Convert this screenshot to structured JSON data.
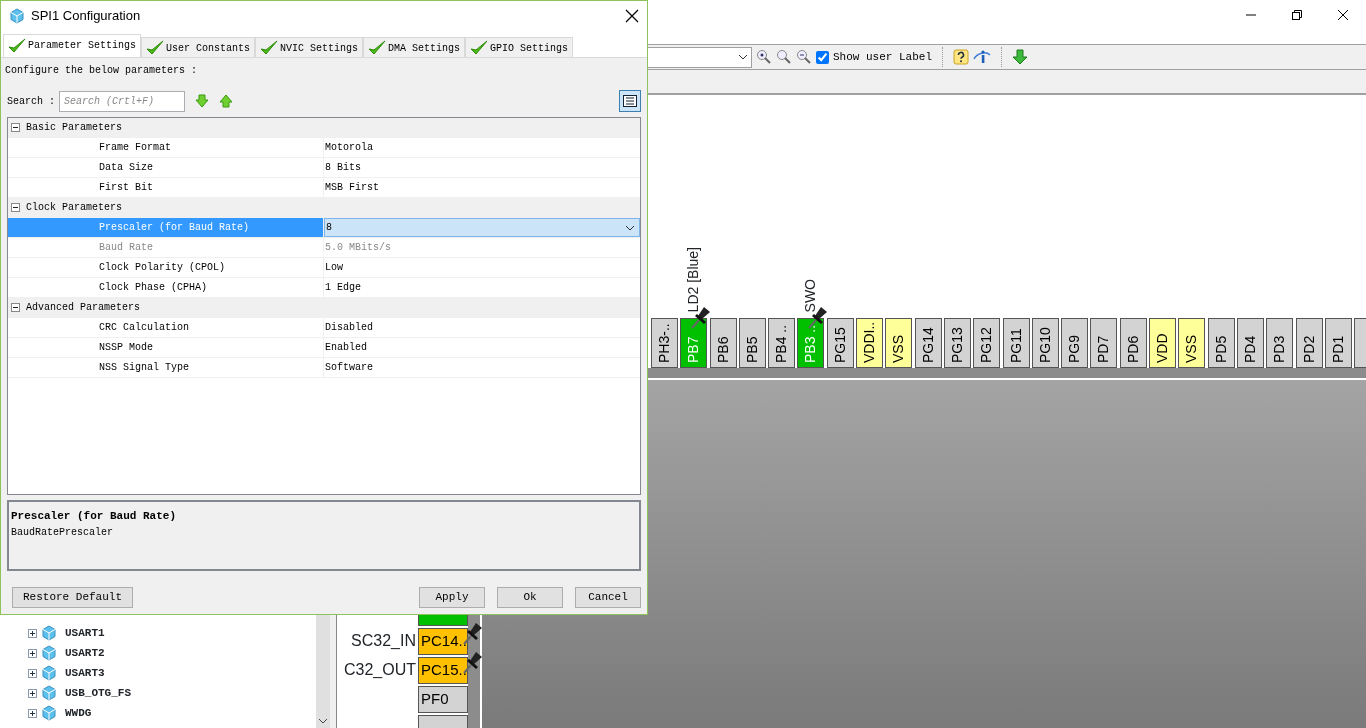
{
  "toolbar": {
    "show_user_label": {
      "label": "Show user Label",
      "checked": true
    }
  },
  "top_pins": [
    {
      "label": "PH3-..",
      "color": "#d3d3d3",
      "pinned": false
    },
    {
      "label": "PB7",
      "color": "#00c000",
      "pinned": true,
      "signal": "LD2 [Blue]"
    },
    {
      "label": "PB6",
      "color": "#d3d3d3",
      "pinned": false
    },
    {
      "label": "PB5",
      "color": "#d3d3d3",
      "pinned": false
    },
    {
      "label": "PB4 ..",
      "color": "#d3d3d3",
      "pinned": false
    },
    {
      "label": "PB3 ..",
      "color": "#00c000",
      "pinned": true,
      "signal": "SWO"
    },
    {
      "label": "PG15",
      "color": "#d3d3d3",
      "pinned": false
    },
    {
      "label": "VDDI..",
      "color": "#ffff99",
      "pinned": false
    },
    {
      "label": "VSS",
      "color": "#ffff99",
      "pinned": false
    },
    {
      "label": "PG14",
      "color": "#d3d3d3",
      "pinned": false
    },
    {
      "label": "PG13",
      "color": "#d3d3d3",
      "pinned": false
    },
    {
      "label": "PG12",
      "color": "#d3d3d3",
      "pinned": false
    },
    {
      "label": "PG11",
      "color": "#d3d3d3",
      "pinned": false
    },
    {
      "label": "PG10",
      "color": "#d3d3d3",
      "pinned": false
    },
    {
      "label": "PG9",
      "color": "#d3d3d3",
      "pinned": false
    },
    {
      "label": "PD7",
      "color": "#d3d3d3",
      "pinned": false
    },
    {
      "label": "PD6",
      "color": "#d3d3d3",
      "pinned": false
    },
    {
      "label": "VDD",
      "color": "#ffff99",
      "pinned": false
    },
    {
      "label": "VSS",
      "color": "#ffff99",
      "pinned": false
    },
    {
      "label": "PD5",
      "color": "#d3d3d3",
      "pinned": false
    },
    {
      "label": "PD4",
      "color": "#d3d3d3",
      "pinned": false
    },
    {
      "label": "PD3",
      "color": "#d3d3d3",
      "pinned": false
    },
    {
      "label": "PD2",
      "color": "#d3d3d3",
      "pinned": false
    },
    {
      "label": "PD1",
      "color": "#d3d3d3",
      "pinned": false
    },
    {
      "color": "#d3d3d3",
      "pinned": false
    }
  ],
  "left_pins": [
    {
      "color": "#00c000",
      "pinned": false
    },
    {
      "label": "PC14..",
      "color": "#ffc000",
      "pinned": true,
      "signal": "SC32_IN"
    },
    {
      "label": "PC15..",
      "color": "#ffc000",
      "pinned": true,
      "signal": "C32_OUT"
    },
    {
      "label": "PF0",
      "color": "#d3d3d3",
      "pinned": false
    },
    {
      "color": "#d3d3d3",
      "pinned": false
    }
  ],
  "peripherals": [
    {
      "label": "USART1",
      "expanded": false
    },
    {
      "label": "USART2",
      "expanded": false
    },
    {
      "label": "USART3",
      "expanded": false
    },
    {
      "label": "USB_OTG_FS",
      "expanded": false
    },
    {
      "label": "WWDG",
      "expanded": false
    }
  ],
  "dialog": {
    "title": "SPI1 Configuration",
    "tabs": [
      {
        "label": "Parameter Settings",
        "selected": true
      },
      {
        "label": "User Constants",
        "selected": false
      },
      {
        "label": "NVIC Settings",
        "selected": false
      },
      {
        "label": "DMA Settings",
        "selected": false
      },
      {
        "label": "GPIO Settings",
        "selected": false
      }
    ],
    "intro": "Configure the below parameters :",
    "search": {
      "label": "Search :",
      "placeholder": "Search (Crtl+F)"
    },
    "view_toggle": {
      "pressed": true
    },
    "groups": [
      {
        "title": "Basic Parameters",
        "expanded": true,
        "rows": [
          {
            "name": "Frame Format",
            "value": "Motorola",
            "selected": false,
            "disabled": false
          },
          {
            "name": "Data Size",
            "value": "8 Bits",
            "selected": false,
            "disabled": false
          },
          {
            "name": "First Bit",
            "value": "MSB First",
            "selected": false,
            "disabled": false
          }
        ]
      },
      {
        "title": "Clock Parameters",
        "expanded": true,
        "rows": [
          {
            "name": "Prescaler (for Baud Rate)",
            "value": "8",
            "selected": true,
            "disabled": false
          },
          {
            "name": "Baud Rate",
            "value": "5.0 MBits/s",
            "selected": false,
            "disabled": true
          },
          {
            "name": "Clock Polarity (CPOL)",
            "value": "Low",
            "selected": false,
            "disabled": false
          },
          {
            "name": "Clock Phase (CPHA)",
            "value": "1 Edge",
            "selected": false,
            "disabled": false
          }
        ]
      },
      {
        "title": "Advanced Parameters",
        "expanded": true,
        "rows": [
          {
            "name": "CRC Calculation",
            "value": "Disabled",
            "selected": false,
            "disabled": false
          },
          {
            "name": "NSSP Mode",
            "value": "Enabled",
            "selected": false,
            "disabled": false
          },
          {
            "name": "NSS Signal Type",
            "value": "Software",
            "selected": false,
            "disabled": false
          }
        ]
      }
    ],
    "description": {
      "title": "Prescaler (for Baud Rate)",
      "text": "BaudRatePrescaler"
    },
    "buttons": [
      "Restore Default",
      "Apply",
      "Ok",
      "Cancel"
    ]
  }
}
